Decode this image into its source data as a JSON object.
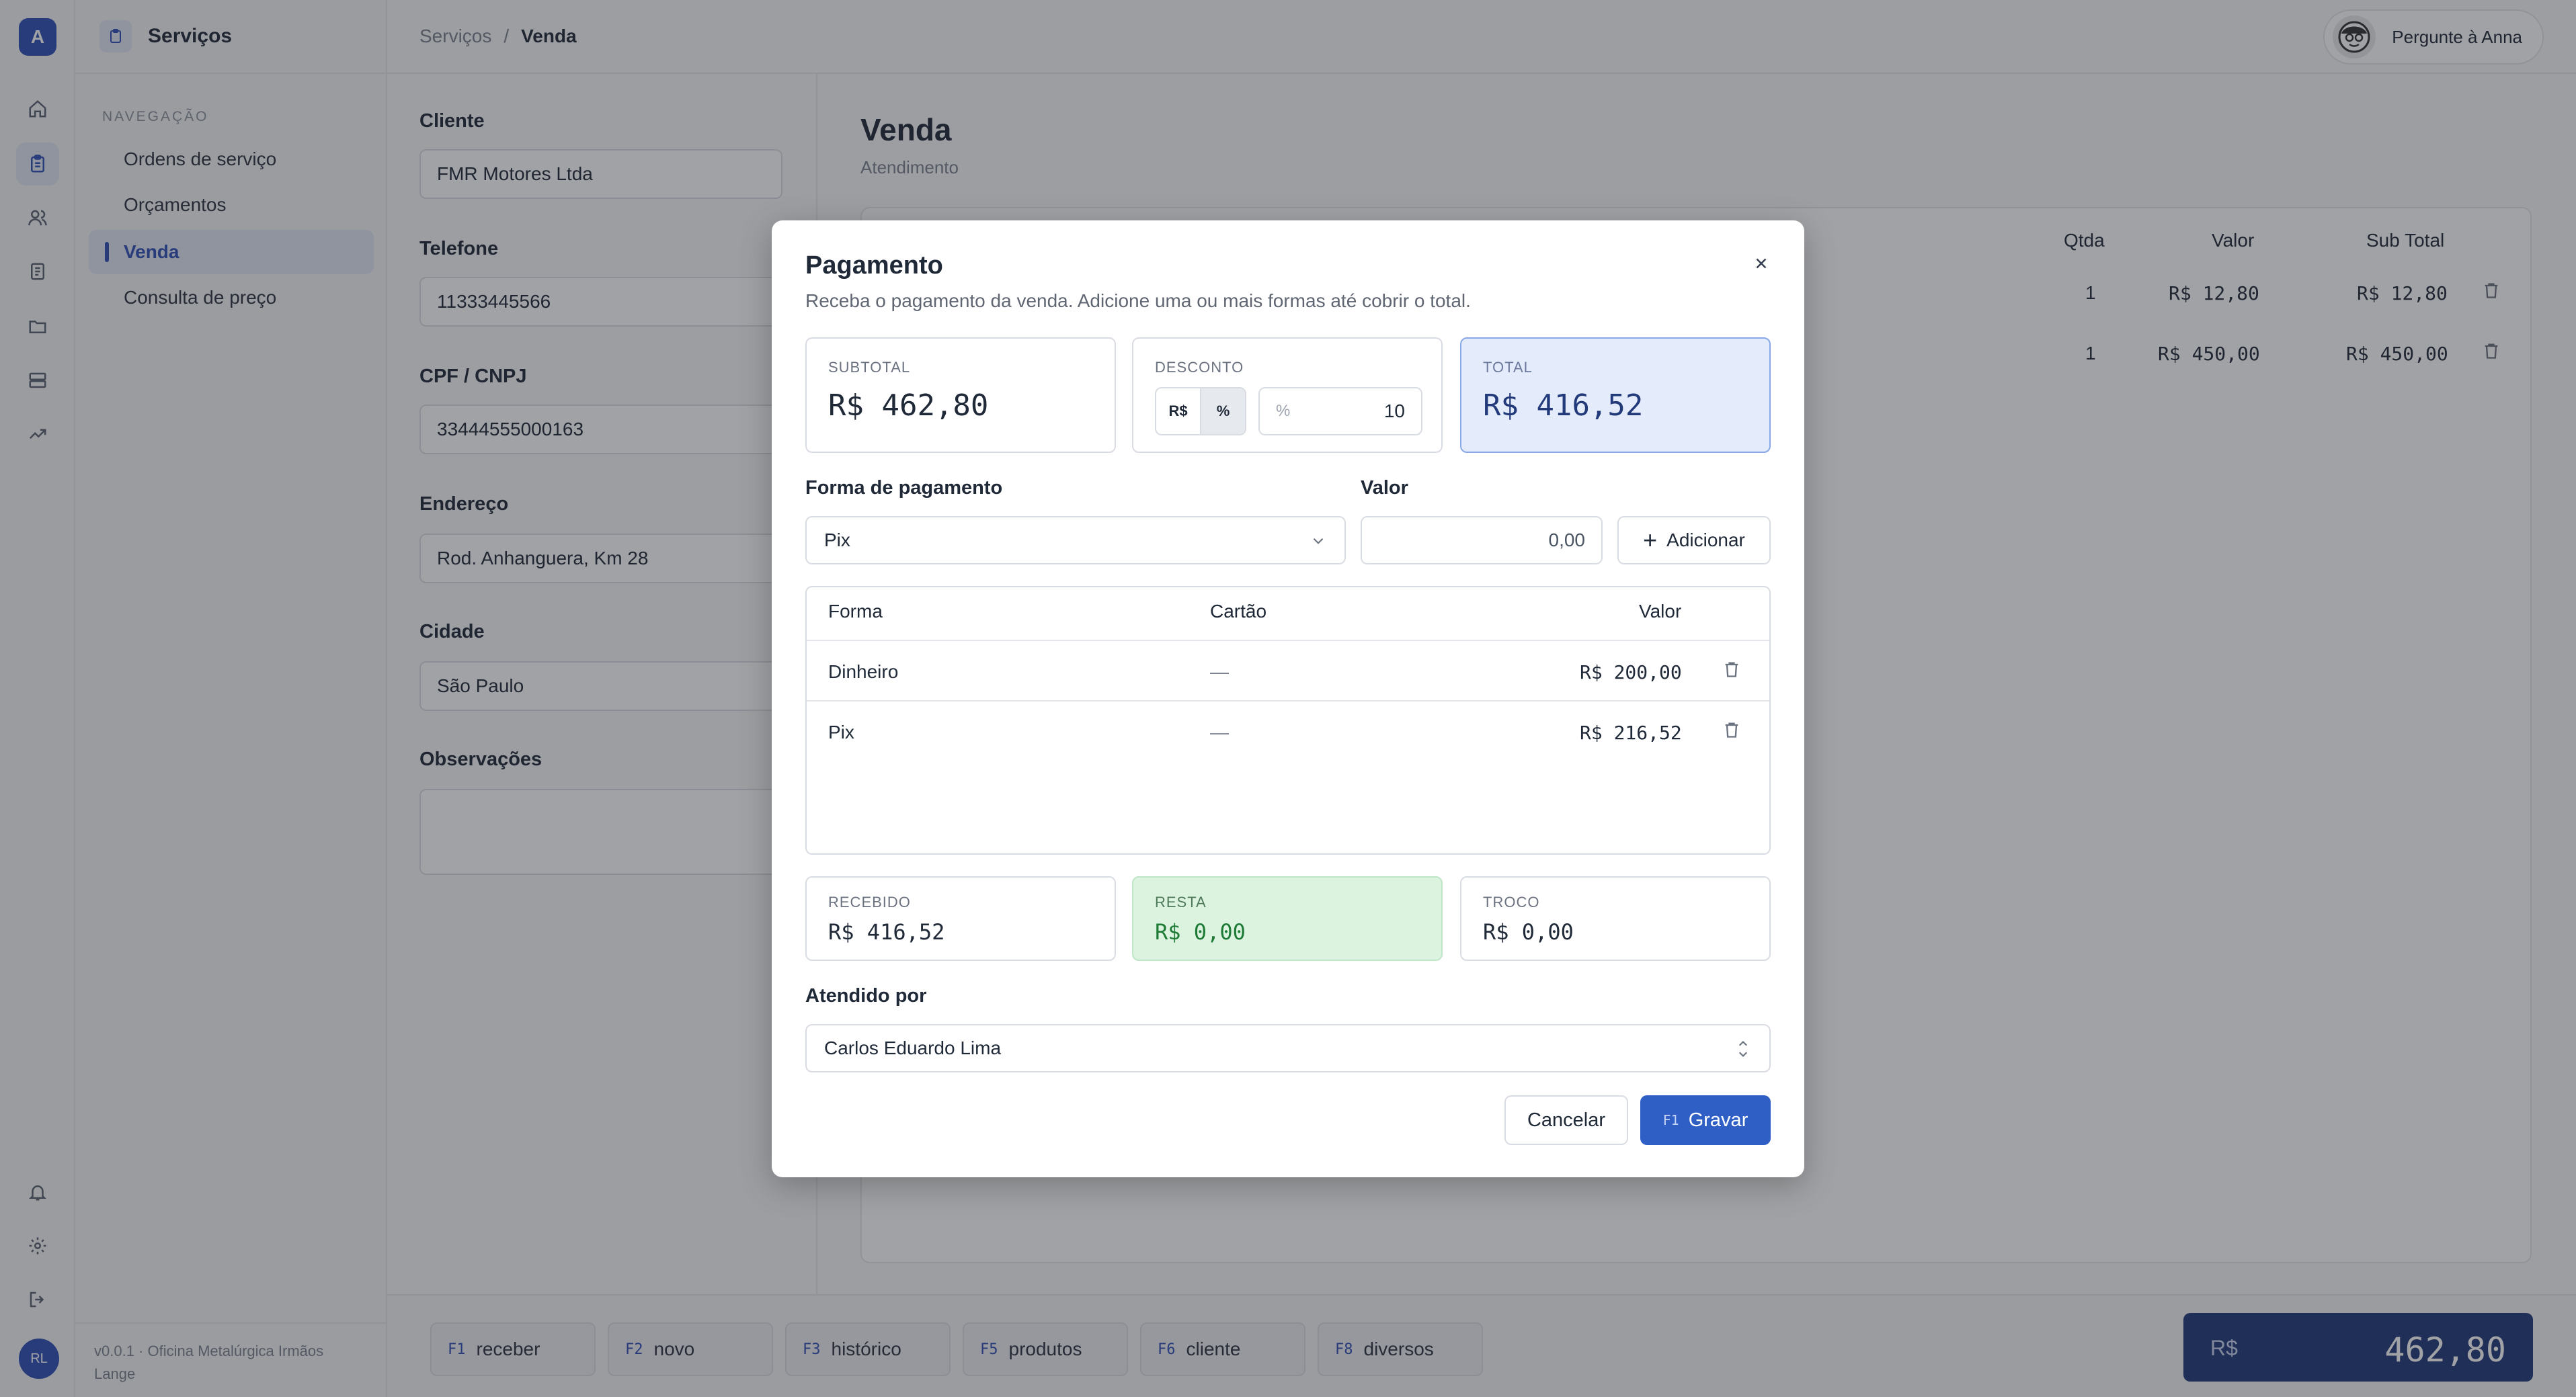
{
  "app": {
    "logo_letter": "A",
    "user_initials": "RL"
  },
  "sidebar": {
    "title": "Serviços",
    "section_label": "NAVEGAÇÃO",
    "items": [
      {
        "label": "Ordens de serviço"
      },
      {
        "label": "Orçamentos"
      },
      {
        "label": "Venda",
        "active": true
      },
      {
        "label": "Consulta de preço"
      }
    ],
    "footer": "v0.0.1 · Oficina Metalúrgica Irmãos Lange"
  },
  "breadcrumb": {
    "parent": "Serviços",
    "separator": "/",
    "current": "Venda"
  },
  "assistant": {
    "label": "Pergunte à Anna"
  },
  "customer_form": {
    "client_label": "Cliente",
    "client_value": "FMR Motores Ltda",
    "phone_label": "Telefone",
    "phone_value": "11333445566",
    "doc_label": "CPF / CNPJ",
    "doc_value": "33444555000163",
    "address_label": "Endereço",
    "address_value": "Rod. Anhanguera, Km 28",
    "city_label": "Cidade",
    "city_value": "São Paulo",
    "notes_label": "Observações",
    "notes_value": ""
  },
  "sale": {
    "title": "Venda",
    "subtitle": "Atendimento",
    "columns": {
      "qty": "Qtda",
      "value": "Valor",
      "subtotal": "Sub Total"
    },
    "items": [
      {
        "qty": "1",
        "value": "R$ 12,80",
        "subtotal": "R$ 12,80"
      },
      {
        "qty": "1",
        "value": "R$ 450,00",
        "subtotal": "R$ 450,00"
      }
    ]
  },
  "function_keys": [
    {
      "key": "F1",
      "label": "receber"
    },
    {
      "key": "F2",
      "label": "novo"
    },
    {
      "key": "F3",
      "label": "histórico"
    },
    {
      "key": "F5",
      "label": "produtos"
    },
    {
      "key": "F6",
      "label": "cliente"
    },
    {
      "key": "F8",
      "label": "diversos"
    }
  ],
  "grand_total": {
    "currency": "R$",
    "value": "462,80"
  },
  "payment_modal": {
    "title": "Pagamento",
    "subtitle": "Receba o pagamento da venda. Adicione uma ou mais formas até cobrir o total.",
    "subtotal_label": "SUBTOTAL",
    "subtotal_value": "R$ 462,80",
    "discount_label": "DESCONTO",
    "discount_mode_currency": "R$",
    "discount_mode_percent": "%",
    "discount_active_mode": "%",
    "discount_input_prefix": "%",
    "discount_value": "10",
    "total_label": "TOTAL",
    "total_value": "R$ 416,52",
    "method_label": "Forma de pagamento",
    "method_value": "Pix",
    "amount_label": "Valor",
    "amount_value": "0,00",
    "add_button": "Adicionar",
    "table_headers": {
      "method": "Forma",
      "card": "Cartão",
      "value": "Valor"
    },
    "payments": [
      {
        "method": "Dinheiro",
        "card": "—",
        "value": "R$ 200,00"
      },
      {
        "method": "Pix",
        "card": "—",
        "value": "R$ 216,52"
      }
    ],
    "received_label": "RECEBIDO",
    "received_value": "R$ 416,52",
    "remaining_label": "RESTA",
    "remaining_value": "R$ 0,00",
    "change_label": "TROCO",
    "change_value": "R$ 0,00",
    "attendant_label": "Atendido por",
    "attendant_value": "Carlos Eduardo Lima",
    "cancel_button": "Cancelar",
    "save_key": "F1",
    "save_button": "Gravar"
  },
  "colors": {
    "accent": "#2f5fc4",
    "brand": "#2f4fb5",
    "total_bg": "#22397a",
    "success_bg": "#dcf3e0",
    "success_text": "#1d7a35"
  }
}
